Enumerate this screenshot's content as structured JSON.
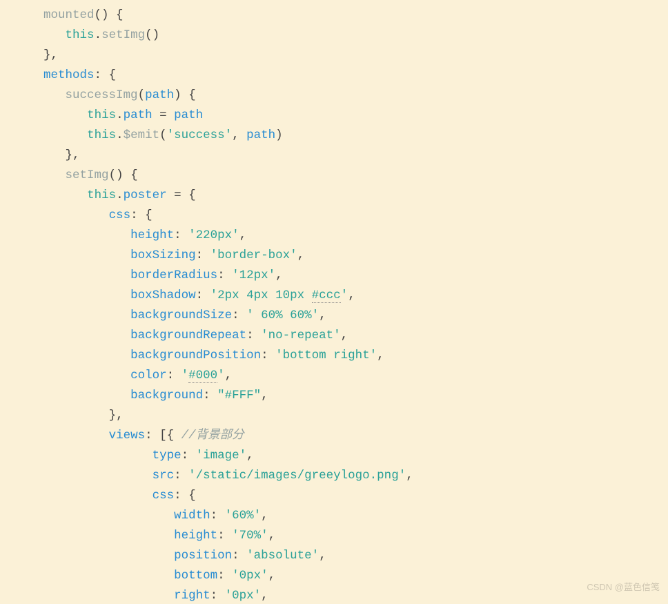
{
  "code": {
    "indent": "   ",
    "kw_this": "this",
    "mounted_name": "mounted",
    "mounted_call": "setImg",
    "methods_label": "methods",
    "successImg_name": "successImg",
    "successImg_param": "path",
    "assign_prop": "path",
    "assign_rhs": "path",
    "emit_name": "$emit",
    "emit_event": "'success'",
    "emit_arg": "path",
    "setImg_name": "setImg",
    "poster_prop": "poster",
    "css_key": "css",
    "css_height_k": "height",
    "css_height_v": "'220px'",
    "css_boxSizing_k": "boxSizing",
    "css_boxSizing_v": "'border-box'",
    "css_borderRadius_k": "borderRadius",
    "css_borderRadius_v": "'12px'",
    "css_boxShadow_k": "boxShadow",
    "css_boxShadow_v_a": "'2px 4px 10px ",
    "css_boxShadow_v_b": "#ccc",
    "css_boxShadow_v_c": "'",
    "css_backgroundSize_k": "backgroundSize",
    "css_backgroundSize_v": "' 60% 60%'",
    "css_backgroundRepeat_k": "backgroundRepeat",
    "css_backgroundRepeat_v": "'no-repeat'",
    "css_backgroundPosition_k": "backgroundPosition",
    "css_backgroundPosition_v": "'bottom right'",
    "css_color_k": "color",
    "css_color_v_a": "'",
    "css_color_v_b": "#000",
    "css_color_v_c": "'",
    "css_background_k": "background",
    "css_background_v": "\"#FFF\"",
    "views_key": "views",
    "views_comment": "//背景部分",
    "v_type_k": "type",
    "v_type_v": "'image'",
    "v_src_k": "src",
    "v_src_v": "'/static/images/greeylogo.png'",
    "v_css_k": "css",
    "v_width_k": "width",
    "v_width_v": "'60%'",
    "v_height_k": "height",
    "v_height_v": "'70%'",
    "v_position_k": "position",
    "v_position_v": "'absolute'",
    "v_bottom_k": "bottom",
    "v_bottom_v": "'0px'",
    "v_right_k": "right",
    "v_right_v": "'0px'"
  },
  "watermark": "CSDN @蓝色信笺"
}
